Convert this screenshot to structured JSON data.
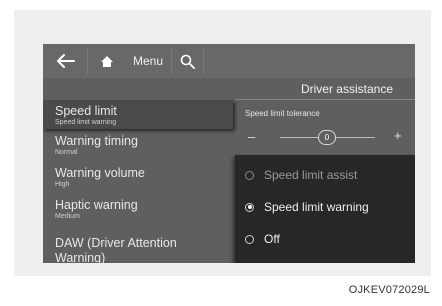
{
  "topbar": {
    "menu_label": "Menu"
  },
  "header": {
    "title": "Driver assistance"
  },
  "left_menu": [
    {
      "title": "Speed limit",
      "subtitle": "Speed limit warning"
    },
    {
      "title": "Warning timing",
      "subtitle": "Normal"
    },
    {
      "title": "Warning volume",
      "subtitle": "High"
    },
    {
      "title": "Haptic warning",
      "subtitle": "Medium"
    },
    {
      "title": "DAW (Driver Attention Warning)",
      "subtitle": ""
    }
  ],
  "tolerance": {
    "label": "Speed limit tolerance",
    "minus": "–",
    "plus": "+",
    "value": "0"
  },
  "options": [
    {
      "label": "Speed limit assist",
      "selected": false
    },
    {
      "label": "Speed limit warning",
      "selected": true
    },
    {
      "label": "Off",
      "selected": false
    }
  ],
  "caption": "OJKEV072029L"
}
